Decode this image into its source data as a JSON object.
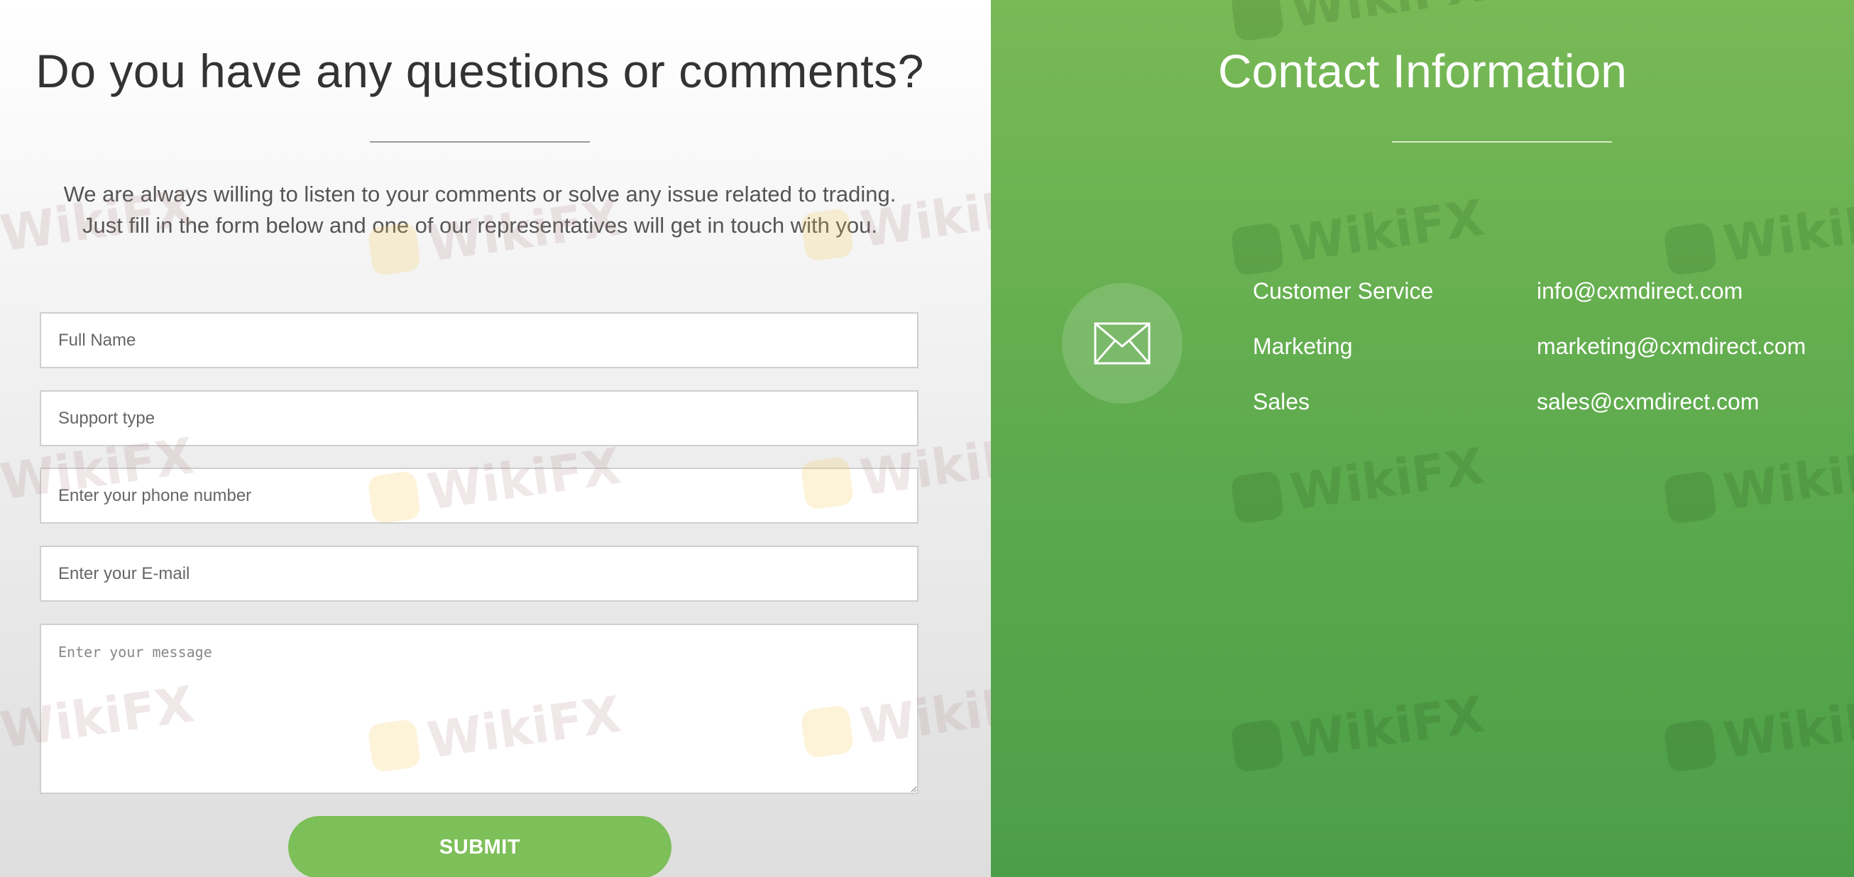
{
  "form_panel": {
    "heading": "Do you have any questions or comments?",
    "intro_line1": "We are always willing to listen to your comments or solve any issue related to trading.",
    "intro_line2": "Just fill in the form below and one of our representatives will get in touch with you.",
    "fields": {
      "full_name_placeholder": "Full Name",
      "support_type_placeholder": "Support type",
      "phone_placeholder": "Enter your phone number",
      "email_placeholder": "Enter your E-mail",
      "message_placeholder": "Enter your message"
    },
    "submit_label": "SUBMIT"
  },
  "contact_panel": {
    "heading": "Contact Information",
    "icon": "envelope-icon",
    "contacts": [
      {
        "label": "Customer Service",
        "email": "info@cxmdirect.com"
      },
      {
        "label": "Marketing",
        "email": "marketing@cxmdirect.com"
      },
      {
        "label": "Sales",
        "email": "sales@cxmdirect.com"
      }
    ]
  },
  "watermark": {
    "text": "WikiFX"
  },
  "colors": {
    "accent_green": "#7dbf58",
    "panel_green_top": "#79b956",
    "panel_green_bottom": "#4c9e48",
    "text_dark": "#333333"
  }
}
